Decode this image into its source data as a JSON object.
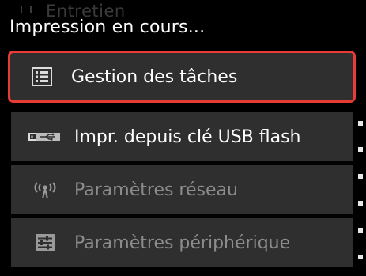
{
  "background_hint": {
    "label": "Entretien"
  },
  "status": {
    "text": "Impression en cours..."
  },
  "menu": {
    "items": [
      {
        "label": "Gestion des tâches",
        "icon": "list-icon",
        "selected": true,
        "enabled": true
      },
      {
        "label": "Impr. depuis clé USB flash",
        "icon": "usb-icon",
        "selected": false,
        "enabled": true
      },
      {
        "label": "Paramètres réseau",
        "icon": "wireless-antenna-icon",
        "selected": false,
        "enabled": false
      },
      {
        "label": "Paramètres périphérique",
        "icon": "device-settings-icon",
        "selected": false,
        "enabled": false
      }
    ]
  },
  "colors": {
    "selection_border": "#e83b36",
    "item_background": "#2f2f2f",
    "disabled_text": "#8c8c8c"
  }
}
